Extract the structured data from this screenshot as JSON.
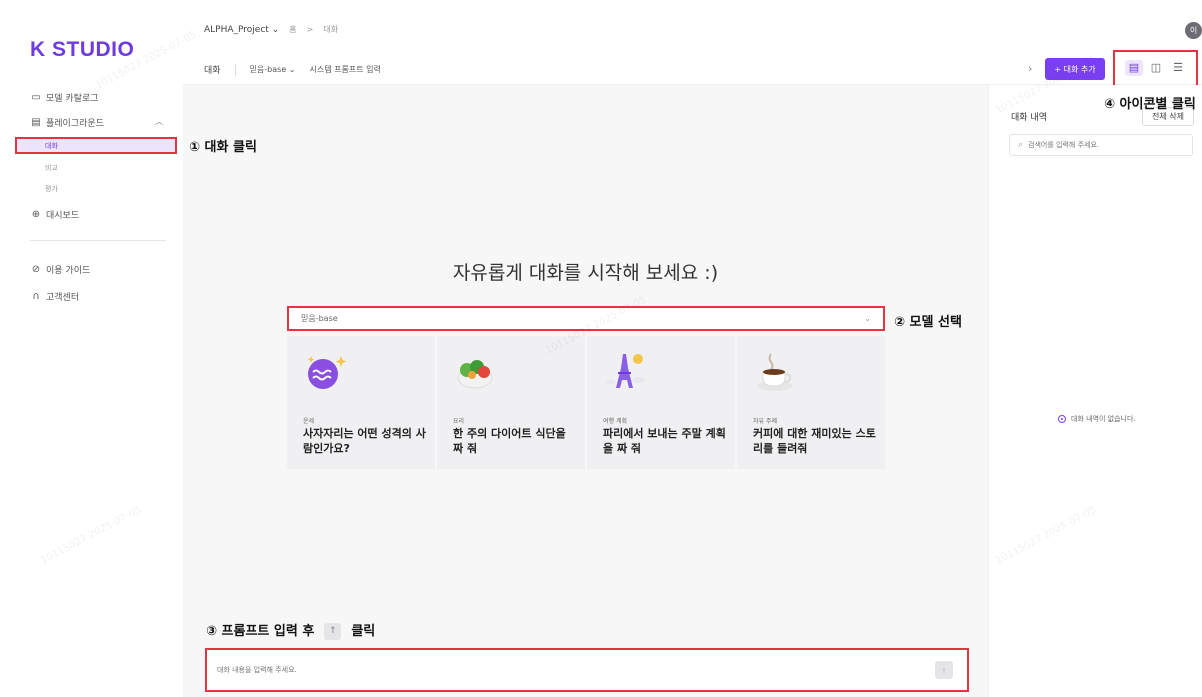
{
  "app": {
    "logo": "K STUDIO",
    "avatar_initial": "이"
  },
  "sidebar": {
    "model_catalog": "모델 카탈로그",
    "playground": "플레이그라운드",
    "sub_chat": "대화",
    "sub_compare": "비교",
    "sub_eval": "평가",
    "dashboard": "대시보드",
    "guide": "이용 가이드",
    "support": "고객센터"
  },
  "header": {
    "project": "ALPHA_Project",
    "crumb_home": "홈",
    "crumb_sep": ">",
    "crumb_current": "대화"
  },
  "tabs": {
    "chat": "대화",
    "model": "믿음-base",
    "system_prompt": "시스템 프롬프트 입력"
  },
  "toolbar": {
    "add_chat": "+ 대화 추가"
  },
  "right_panel": {
    "title": "대화 내역",
    "clear_all": "전체 삭제",
    "search_placeholder": "검색어를 입력해 주세요.",
    "empty": "대화 내역이 없습니다."
  },
  "main": {
    "hero": "자유롭게 대화를 시작해 보세요 :)",
    "model_selected": "믿음-base",
    "prompt_placeholder": "대화 내용을 입력해 주세요."
  },
  "cards": [
    {
      "category": "운세",
      "text": "사자자리는 어떤 성격의 사람인가요?"
    },
    {
      "category": "요리",
      "text": "한 주의 다이어트 식단을 짜 줘"
    },
    {
      "category": "여행 계획",
      "text": "파리에서 보내는 주말 계획을 짜 줘"
    },
    {
      "category": "자유 주제",
      "text": "커피에 대한 재미있는 스토리를 들려줘"
    }
  ],
  "annotations": {
    "step1": "① 대화 클릭",
    "step2": "② 모델 선택",
    "step3_a": "③ 프롬프트 입력 후",
    "step3_b": "클릭",
    "step4": "④ 아이콘별 클릭"
  },
  "watermark": "10115027 2025-07-05",
  "colors": {
    "brand": "#6f3bdc",
    "accent": "#7b3ff2",
    "annotation_red": "#e53342"
  }
}
